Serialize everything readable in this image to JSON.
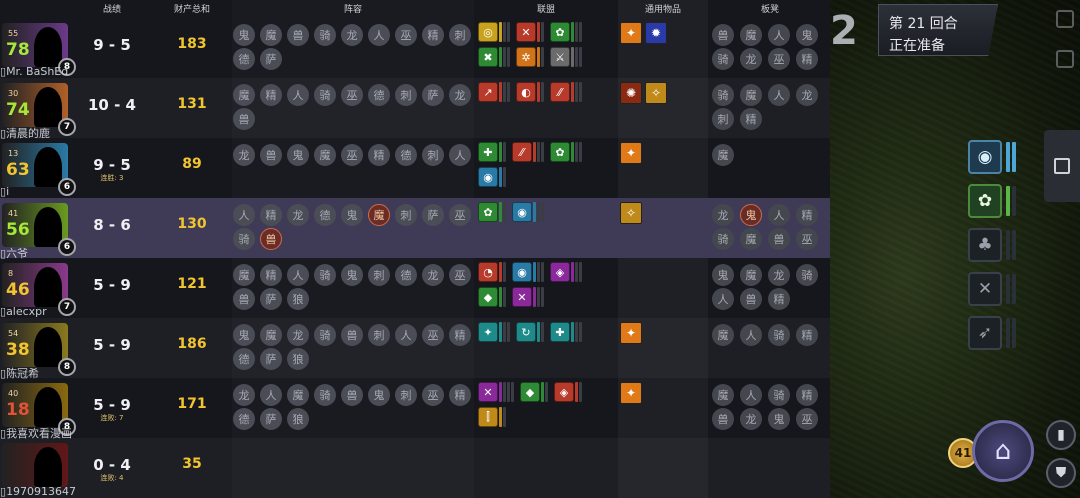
{
  "round": {
    "number_big": "2",
    "label": "第 21 回合",
    "status": "正在准备"
  },
  "headers": {
    "record": "战绩",
    "wealth": "财产总和",
    "lineup": "阵容",
    "alliances": "联盟",
    "items": "通用物品",
    "bench": "板凳"
  },
  "gold": "41",
  "colors": {
    "wealth": "#f2c530",
    "hp_high": "#a6e83a",
    "hp_mid": "#f2c530",
    "hp_low": "#e0523a"
  },
  "players": [
    {
      "name": "Mr. BaShEd",
      "hp": "78",
      "level_small": "55",
      "level": "8",
      "record": "9 - 5",
      "streak": "",
      "wealth": "183",
      "portrait_bg": "#6b3a8a",
      "hp_color": "#a6e83a",
      "lineup": [
        "鬼",
        "魔",
        "兽",
        "骑",
        "龙",
        "人",
        "巫",
        "精",
        "刺",
        "德",
        "萨"
      ],
      "alliances": [
        {
          "icon": "◎",
          "color": "#c8a21e",
          "pips": 3
        },
        {
          "icon": "✕",
          "color": "#b73a2a",
          "pips": 2
        },
        {
          "icon": "✿",
          "color": "#2e8a34",
          "pips": 3
        },
        {
          "icon": "✖",
          "color": "#2e8a34",
          "pips": 3
        },
        {
          "icon": "✲",
          "color": "#d17318",
          "pips": 2
        },
        {
          "icon": "⚔",
          "color": "#6b6b6b",
          "pips": 3
        }
      ],
      "items": [
        {
          "icon": "✦",
          "color": "#e07a18"
        },
        {
          "icon": "✹",
          "color": "#2a3aa8"
        }
      ],
      "bench": [
        "兽",
        "魔",
        "人",
        "鬼",
        "骑",
        "龙",
        "巫",
        "精"
      ]
    },
    {
      "name": "清晨的鹿",
      "hp": "74",
      "level_small": "30",
      "level": "7",
      "record": "10 - 4",
      "streak": "",
      "wealth": "131",
      "portrait_bg": "#b0602a",
      "hp_color": "#a6e83a",
      "lineup": [
        "魔",
        "精",
        "人",
        "骑",
        "巫",
        "德",
        "刺",
        "萨",
        "龙",
        "兽"
      ],
      "alliances": [
        {
          "icon": "↗",
          "color": "#b73a2a",
          "pips": 3
        },
        {
          "icon": "◐",
          "color": "#b73a2a",
          "pips": 2
        },
        {
          "icon": "⁄⁄",
          "color": "#b73a2a",
          "pips": 3
        }
      ],
      "items": [
        {
          "icon": "✺",
          "color": "#8a2a12"
        },
        {
          "icon": "✧",
          "color": "#c08a1a"
        }
      ],
      "bench": [
        "骑",
        "魔",
        "人",
        "龙",
        "刺",
        "精"
      ]
    },
    {
      "name": "i",
      "hp": "63",
      "level_small": "13",
      "level": "6",
      "record": "9 - 5",
      "streak": "连胜: 3",
      "wealth": "89",
      "portrait_bg": "#2a7aa6",
      "hp_color": "#f2c530",
      "lineup": [
        "龙",
        "兽",
        "鬼",
        "魔",
        "巫",
        "精",
        "德",
        "刺",
        "人"
      ],
      "alliances": [
        {
          "icon": "✚",
          "color": "#2e8a34",
          "pips": 2
        },
        {
          "icon": "⁄⁄",
          "color": "#b73a2a",
          "pips": 3
        },
        {
          "icon": "✿",
          "color": "#2e8a34",
          "pips": 3
        },
        {
          "icon": "◉",
          "color": "#2a7aa6",
          "pips": 2
        }
      ],
      "items": [
        {
          "icon": "✦",
          "color": "#e07a18"
        }
      ],
      "bench": [
        "魔"
      ]
    },
    {
      "name": "六爷",
      "hp": "56",
      "level_small": "41",
      "level": "6",
      "record": "8 - 6",
      "streak": "",
      "wealth": "130",
      "portrait_bg": "#6a9a20",
      "hp_color": "#a6e83a",
      "self": true,
      "lineup": [
        "人",
        "精",
        "龙",
        "德",
        "鬼",
        "魔",
        "刺",
        "萨",
        "巫",
        "骑",
        "兽"
      ],
      "alliances": [
        {
          "icon": "✿",
          "color": "#2e8a34",
          "pips": 2
        },
        {
          "icon": "◉",
          "color": "#2a7aa6",
          "pips": 3
        }
      ],
      "items": [
        {
          "icon": "✧",
          "color": "#c08a1a"
        }
      ],
      "bench": [
        "龙",
        "鬼",
        "人",
        "精",
        "骑",
        "魔",
        "兽",
        "巫"
      ]
    },
    {
      "name": "alecxpr",
      "hp": "46",
      "level_small": "8",
      "level": "7",
      "record": "5 - 9",
      "streak": "",
      "wealth": "121",
      "portrait_bg": "#8a3a8a",
      "hp_color": "#f2c530",
      "lineup": [
        "魔",
        "精",
        "人",
        "骑",
        "鬼",
        "刺",
        "德",
        "龙",
        "巫",
        "兽",
        "萨",
        "狼"
      ],
      "alliances": [
        {
          "icon": "◔",
          "color": "#b73a2a",
          "pips": 2
        },
        {
          "icon": "◉",
          "color": "#2a7aa6",
          "pips": 3
        },
        {
          "icon": "◈",
          "color": "#8a2a9a",
          "pips": 3
        },
        {
          "icon": "◆",
          "color": "#2e8a34",
          "pips": 2
        },
        {
          "icon": "✕",
          "color": "#8a2a9a",
          "pips": 3
        }
      ],
      "items": [],
      "bench": [
        "鬼",
        "魔",
        "龙",
        "骑",
        "人",
        "兽",
        "精"
      ]
    },
    {
      "name": "陈冠希",
      "hp": "38",
      "level_small": "54",
      "level": "8",
      "record": "5 - 9",
      "streak": "",
      "wealth": "186",
      "portrait_bg": "#8a7a20",
      "hp_color": "#f2c530",
      "lineup": [
        "鬼",
        "魔",
        "龙",
        "骑",
        "兽",
        "刺",
        "人",
        "巫",
        "精",
        "德",
        "萨",
        "狼"
      ],
      "alliances": [
        {
          "icon": "✦",
          "color": "#1e8a8a",
          "pips": 3
        },
        {
          "icon": "↻",
          "color": "#1e8a8a",
          "pips": 2
        },
        {
          "icon": "✚",
          "color": "#1e8a8a",
          "pips": 3
        }
      ],
      "items": [
        {
          "icon": "✦",
          "color": "#e07a18"
        }
      ],
      "bench": [
        "魔",
        "人",
        "骑",
        "精"
      ]
    },
    {
      "name": "我喜欢看漫画",
      "hp": "18",
      "level_small": "40",
      "level": "8",
      "record": "5 - 9",
      "streak": "连败: 7",
      "wealth": "171",
      "portrait_bg": "#8a6a10",
      "hp_color": "#e0523a",
      "lineup": [
        "龙",
        "人",
        "魔",
        "骑",
        "兽",
        "鬼",
        "刺",
        "巫",
        "精",
        "德",
        "萨",
        "狼"
      ],
      "alliances": [
        {
          "icon": "✕",
          "color": "#8a2a9a",
          "pips": 4
        },
        {
          "icon": "◆",
          "color": "#2e8a34",
          "pips": 2
        },
        {
          "icon": "◈",
          "color": "#b73a2a",
          "pips": 2
        },
        {
          "icon": "⫿",
          "color": "#c08a1a",
          "pips": 2
        }
      ],
      "items": [
        {
          "icon": "✦",
          "color": "#e07a18"
        }
      ],
      "bench": [
        "魔",
        "人",
        "骑",
        "精",
        "兽",
        "龙",
        "鬼",
        "巫"
      ]
    },
    {
      "name": "1970913647",
      "hp": "",
      "level_small": "",
      "level": "",
      "record": "0 - 4",
      "streak": "连败: 4",
      "wealth": "35",
      "portrait_bg": "#7a1010",
      "hp_color": "#e0523a",
      "eliminated": true,
      "lineup": [],
      "alliances": [],
      "items": [],
      "bench": []
    }
  ]
}
